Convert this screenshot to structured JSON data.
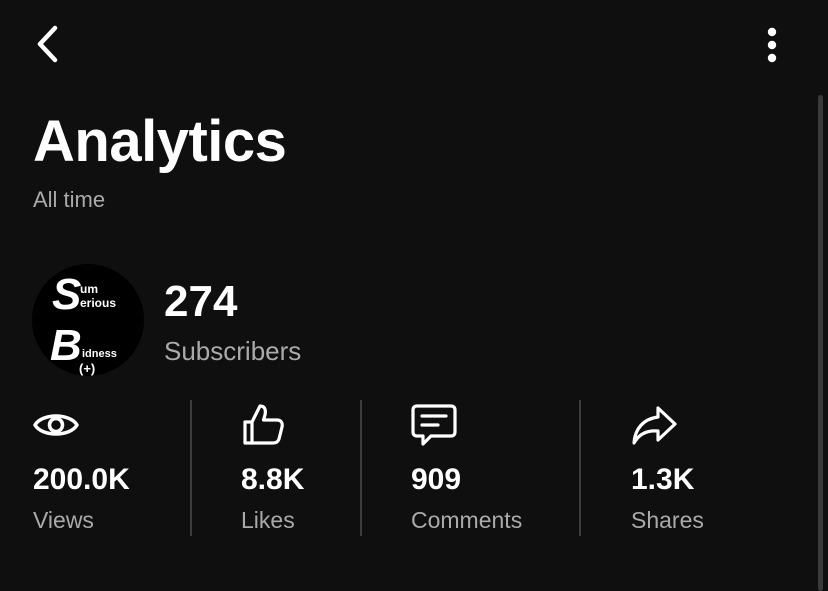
{
  "header": {
    "title": "Analytics",
    "period": "All time",
    "back_icon": "chevron-left-icon",
    "menu_icon": "more-vertical-icon"
  },
  "channel": {
    "subscriber_count": "274",
    "subscriber_label": "Subscribers",
    "avatar_text": {
      "s": "S",
      "um": "um",
      "erious": "erious",
      "b": "B",
      "idness": "idness",
      "plus": "(+)"
    }
  },
  "stats": [
    {
      "icon": "eye-icon",
      "value": "200.0K",
      "label": "Views"
    },
    {
      "icon": "thumbs-up-icon",
      "value": "8.8K",
      "label": "Likes"
    },
    {
      "icon": "comment-icon",
      "value": "909",
      "label": "Comments"
    },
    {
      "icon": "share-icon",
      "value": "1.3K",
      "label": "Shares"
    }
  ],
  "colors": {
    "background": "#0f0f0f",
    "text_primary": "#ffffff",
    "text_secondary": "#aaaaaa",
    "divider": "#3d3d3d"
  }
}
